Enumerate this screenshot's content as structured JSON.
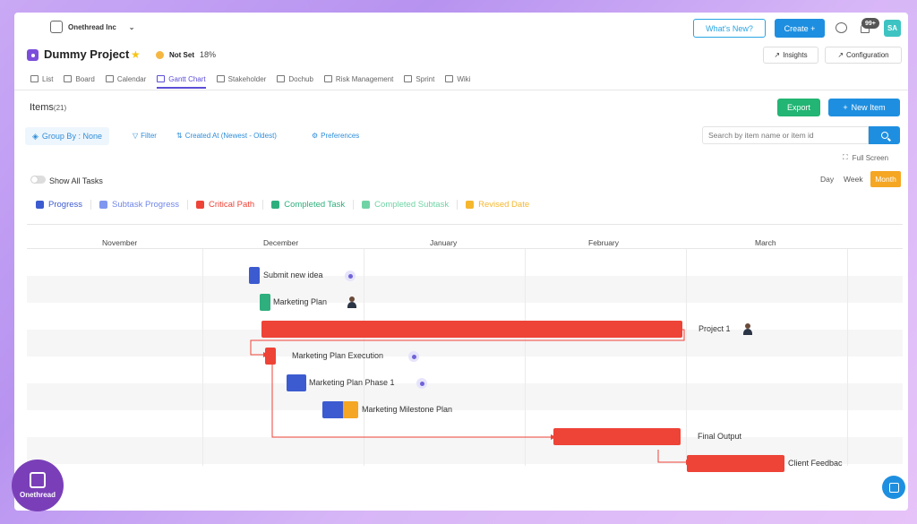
{
  "org": {
    "name": "Onethread Inc"
  },
  "topbar": {
    "whats_new": "What's New?",
    "create": "Create +",
    "notifications": "99+",
    "avatar_initials": "SA"
  },
  "project": {
    "title": "Dummy Project",
    "status": "Not Set",
    "progress": "18%"
  },
  "header_buttons": {
    "insights": "Insights",
    "configuration": "Configuration"
  },
  "tabs": [
    {
      "label": "List",
      "icon": "list-icon"
    },
    {
      "label": "Board",
      "icon": "board-icon"
    },
    {
      "label": "Calendar",
      "icon": "calendar-icon"
    },
    {
      "label": "Gantt Chart",
      "icon": "gantt-icon",
      "active": true
    },
    {
      "label": "Stakeholder",
      "icon": "stakeholder-icon"
    },
    {
      "label": "Dochub",
      "icon": "doc-icon"
    },
    {
      "label": "Risk Management",
      "icon": "risk-icon"
    },
    {
      "label": "Sprint",
      "icon": "sprint-icon"
    },
    {
      "label": "Wiki",
      "icon": "wiki-icon"
    }
  ],
  "items": {
    "title": "Items",
    "count": "(21)"
  },
  "actions": {
    "export": "Export",
    "new_item": "New Item"
  },
  "filters": {
    "group_by": "Group By : None",
    "filter": "Filter",
    "sort": "Created At (Newest - Oldest)",
    "preferences": "Preferences"
  },
  "search": {
    "placeholder": "Search by item name or item id"
  },
  "fullscreen": "Full Screen",
  "show_all_tasks": "Show All Tasks",
  "views": {
    "day": "Day",
    "week": "Week",
    "month": "Month"
  },
  "legend": [
    {
      "label": "Progress",
      "color": "#3c5bd0",
      "text_color": "#3c5bd0"
    },
    {
      "label": "Subtask Progress",
      "color": "#7f97f0",
      "text_color": "#6f86e8"
    },
    {
      "label": "Critical Path",
      "color": "#ee4337",
      "text_color": "#ee4337"
    },
    {
      "label": "Completed Task",
      "color": "#2eaf7d",
      "text_color": "#2eaf7d"
    },
    {
      "label": "Completed Subtask",
      "color": "#6fd3a5",
      "text_color": "#6fd3a5"
    },
    {
      "label": "Revised Date",
      "color": "#f5b72e",
      "text_color": "#f5b72e"
    }
  ],
  "gantt": {
    "months": [
      "November",
      "December",
      "January",
      "February",
      "March"
    ],
    "tasks": [
      {
        "name": "Submit new idea",
        "assignee": "user-icon"
      },
      {
        "name": "Marketing Plan",
        "assignee": "photo"
      },
      {
        "name": "Project 1",
        "assignee": "photo"
      },
      {
        "name": "Marketing Plan Execution",
        "assignee": "user-icon"
      },
      {
        "name": "Marketing Plan Phase 1",
        "assignee": "user-icon"
      },
      {
        "name": "Marketing Milestone Plan",
        "assignee": ""
      },
      {
        "name": "Final Output",
        "assignee": ""
      },
      {
        "name": "Client Feedbac",
        "assignee": ""
      }
    ]
  },
  "brand": {
    "logo_text": "Onethread"
  }
}
